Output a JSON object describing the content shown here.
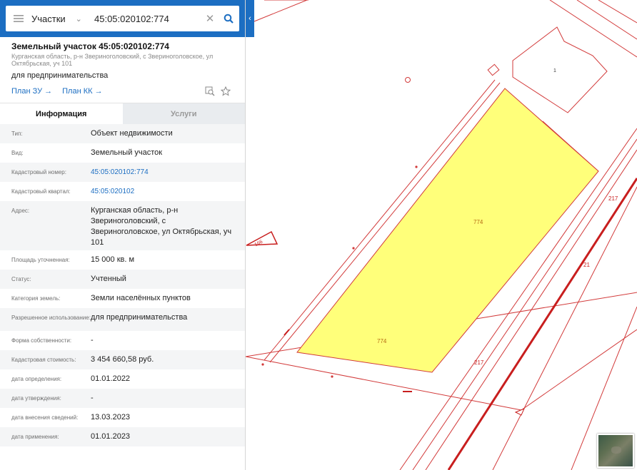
{
  "search": {
    "layer": "Участки",
    "query": "45:05:020102:774"
  },
  "parcel": {
    "title": "Земельный участок 45:05:020102:774",
    "address_short": "Курганская область, р-н Звериноголовский, с Звериноголовское, ул Октябрьская, уч 101",
    "purpose": "для предпринимательства",
    "links": [
      "План ЗУ →",
      "План КК →"
    ]
  },
  "tabs": [
    "Информация",
    "Услуги"
  ],
  "fields": [
    {
      "label": "Тип:",
      "value": "Объект недвижимости"
    },
    {
      "label": "Вид:",
      "value": "Земельный участок"
    },
    {
      "label": "Кадастровый номер:",
      "value": "45:05:020102:774",
      "link": true
    },
    {
      "label": "Кадастровый квартал:",
      "value": "45:05:020102",
      "link": true
    },
    {
      "label": "Адрес:",
      "value": "Курганская область, р-н Звериноголовский, с Звериноголовское, ул Октябрьская, уч 101"
    },
    {
      "label": "Площадь уточненная:",
      "value": "15 000 кв. м"
    },
    {
      "label": "Статус:",
      "value": "Учтенный"
    },
    {
      "label": "Категория земель:",
      "value": "Земли населённых пунктов"
    },
    {
      "label": "Разрешенное использование:",
      "value": "для предпринимательства"
    },
    {
      "label": "Форма собственности:",
      "value": "-"
    },
    {
      "label": "Кадастровая стоимость:",
      "value": "3 454 660,58 руб."
    },
    {
      "label": "дата определения:",
      "value": "01.01.2022"
    },
    {
      "label": "дата утверждения:",
      "value": "-"
    },
    {
      "label": "дата внесения сведений:",
      "value": "13.03.2023"
    },
    {
      "label": "дата применения:",
      "value": "01.01.2023"
    }
  ],
  "map": {
    "labels": {
      "parcel_center": "774",
      "parcel_lower": "774",
      "building": "1",
      "road_217a": "217",
      "road_217b": "217",
      "road_21": "21",
      "marker_166": "166"
    }
  },
  "colors": {
    "header": "#1c6ec2",
    "parcel_fill": "#ffff7a",
    "boundary": "#c81e1e",
    "link": "#1c6ec2"
  },
  "icons": [
    "menu-icon",
    "chevron-down-icon",
    "clear-icon",
    "search-icon",
    "collapse-chevron-icon",
    "zoom-to-icon",
    "star-icon"
  ]
}
